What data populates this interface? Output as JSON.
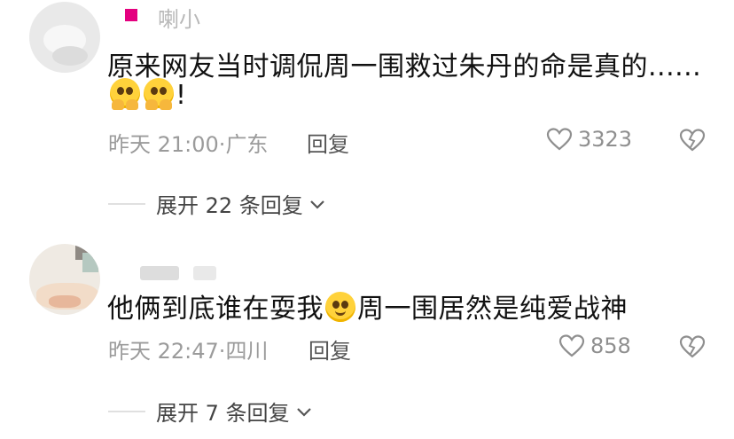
{
  "comments": [
    {
      "username": "喇小",
      "text_before": "原来网友当时调侃周一围救过朱丹的命是真的......",
      "text_line2_suffix": "!",
      "emojis_line2": [
        "pleading-hands-emoji",
        "pleading-hands-emoji"
      ],
      "time": "昨天 21:00",
      "location": "广东",
      "reply_label": "回复",
      "likes": "3323",
      "expand_label": "展开 22 条回复"
    },
    {
      "username": "",
      "text_before": "他俩到底谁在耍我",
      "text_after": "周一围居然是纯爱战神",
      "emoji_inline": "smiling-face-emoji",
      "time": "昨天 22:47",
      "location": "四川",
      "reply_label": "回复",
      "likes": "858",
      "expand_label": "展开 7 条回复"
    }
  ],
  "colors": {
    "text": "#111111",
    "meta": "#9b9b9b",
    "badge": "#e4007f"
  }
}
